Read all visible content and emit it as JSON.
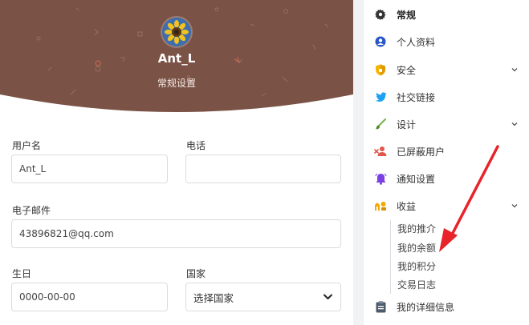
{
  "profile": {
    "name": "Ant_L",
    "subtitle": "常规设置",
    "banner_color": "#7b5246",
    "avatar_icon": "sunflower-avatar"
  },
  "form": {
    "username": {
      "label": "用户名",
      "value": "Ant_L"
    },
    "phone": {
      "label": "电话",
      "value": ""
    },
    "email": {
      "label": "电子邮件",
      "value": "43896821@qq.com"
    },
    "birthday": {
      "label": "生日",
      "value": "0000-00-00"
    },
    "country": {
      "label": "国家",
      "selected": "选择国家"
    }
  },
  "menu": {
    "items": [
      {
        "label": "常规",
        "icon": "gear-icon",
        "active": true
      },
      {
        "label": "个人资料",
        "icon": "profile-icon"
      },
      {
        "label": "安全",
        "icon": "shield-icon",
        "expandable": true
      },
      {
        "label": "社交链接",
        "icon": "twitter-icon"
      },
      {
        "label": "设计",
        "icon": "brush-icon",
        "expandable": true
      },
      {
        "label": "已屏蔽用户",
        "icon": "blocked-user-icon"
      },
      {
        "label": "通知设置",
        "icon": "bell-icon"
      },
      {
        "label": "收益",
        "icon": "earnings-icon",
        "expandable": true
      },
      {
        "label": "我的详细信息",
        "icon": "clipboard-icon"
      }
    ],
    "earnings_sub": [
      {
        "label": "我的推介"
      },
      {
        "label": "我的余额"
      },
      {
        "label": "我的积分"
      },
      {
        "label": "交易日志"
      }
    ]
  },
  "annotation": {
    "type": "red-arrow",
    "target": "我的余额",
    "color": "#e8232a"
  }
}
